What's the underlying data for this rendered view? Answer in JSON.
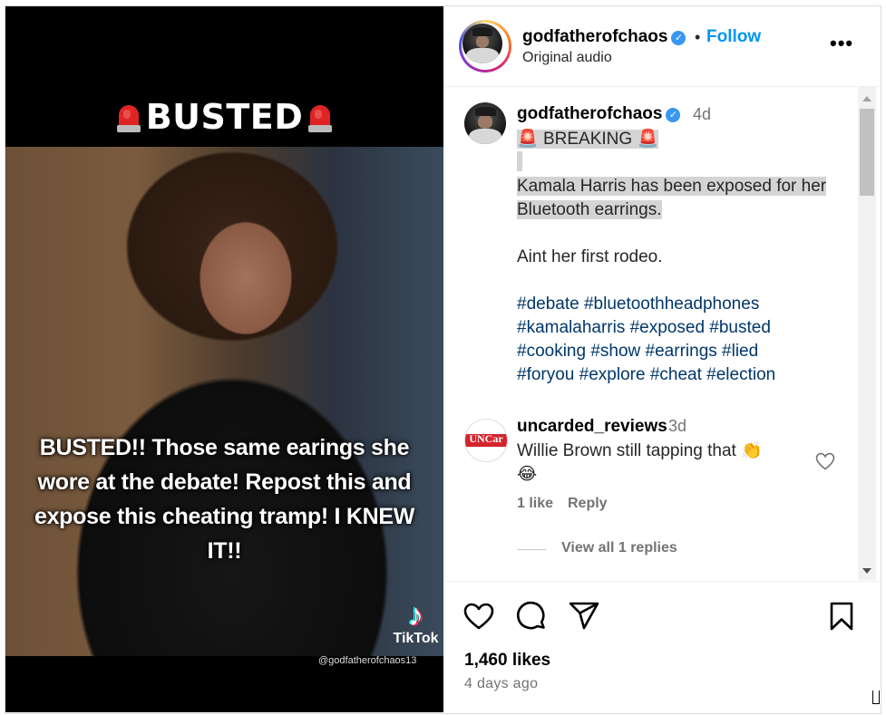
{
  "media": {
    "top_caption": "BUSTED",
    "overlay_text": "BUSTED!! Those same earings she wore at the debate! Repost this and expose this cheating tramp! I KNEW IT!!",
    "tiktok_brand": "TikTok",
    "tiktok_handle": "@godfatherofchaos13"
  },
  "header": {
    "username": "godfatherofchaos",
    "separator": "•",
    "follow_label": "Follow",
    "subtitle": "Original audio",
    "more_label": "•••"
  },
  "caption": {
    "username": "godfatherofchaos",
    "time": "4d",
    "breaking": "BREAKING",
    "line1": "Kamala Harris has been exposed for her Bluetooth earrings.",
    "line2": "Aint her first rodeo.",
    "hashtags": [
      "#debate",
      "#bluetoothheadphones",
      "#kamalaharris",
      "#exposed",
      "#busted",
      "#cooking",
      "#show",
      "#earrings",
      "#lied",
      "#foryou",
      "#explore",
      "#cheat",
      "#election"
    ]
  },
  "comment": {
    "avatar_text": "UNCar",
    "username": "uncarded_reviews",
    "time": "3d",
    "text": "Willie Brown still tapping that 👏",
    "emoji_line": "😂",
    "likes": "1 like",
    "reply_label": "Reply",
    "view_replies": "View all 1 replies"
  },
  "footer": {
    "likes": "1,460 likes",
    "time_ago": "4 days ago"
  },
  "colors": {
    "follow": "#0095f6",
    "hashtag": "#00376b",
    "highlight": "#d4d4d4",
    "verified": "#3897f0",
    "muted": "#737373"
  },
  "icons": [
    "siren-icon",
    "verified-icon",
    "more-icon",
    "heart-icon",
    "comment-icon",
    "share-icon",
    "bookmark-icon",
    "scroll-up-icon",
    "scroll-down-icon"
  ]
}
